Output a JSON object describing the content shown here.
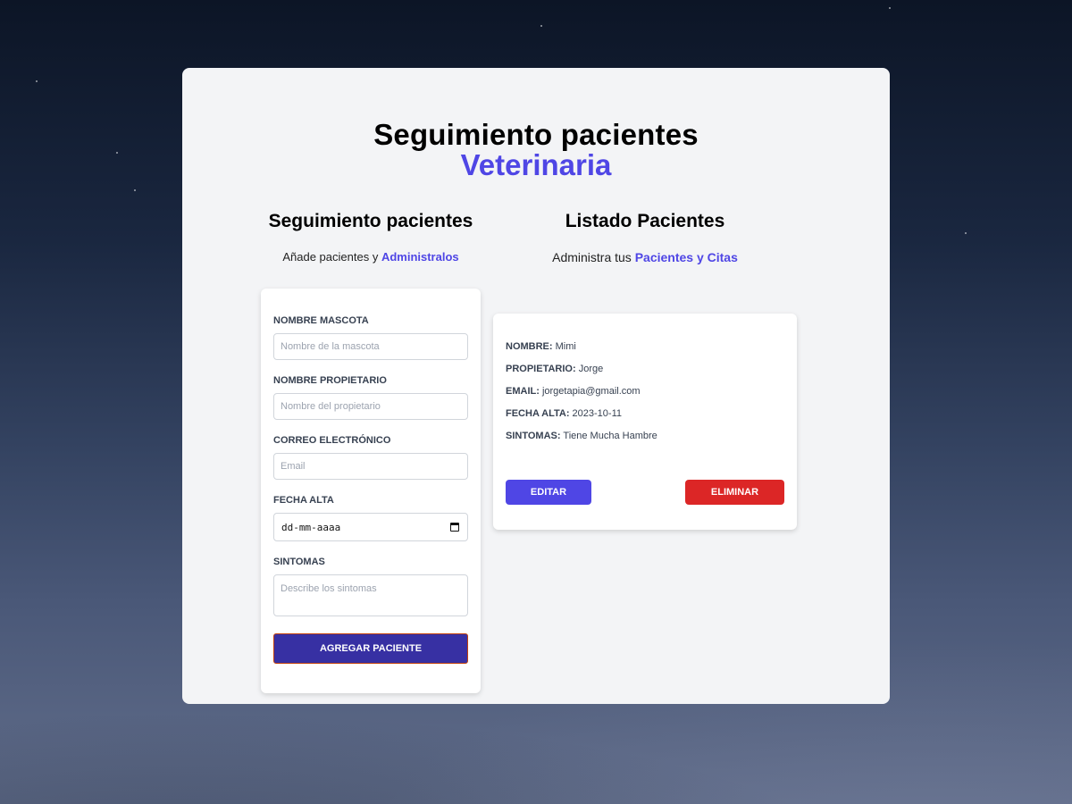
{
  "header": {
    "title": "Seguimiento pacientes",
    "subtitle": "Veterinaria"
  },
  "form_section": {
    "title": "Seguimiento pacientes",
    "sub_prefix": "Añade pacientes y ",
    "sub_accent": "Administralos"
  },
  "list_section": {
    "title": "Listado Pacientes",
    "sub_prefix": "Administra tus ",
    "sub_accent": "Pacientes y Citas"
  },
  "form": {
    "pet_name_label": "Nombre Mascota",
    "pet_name_placeholder": "Nombre de la mascota",
    "pet_name_value": "",
    "owner_label": "Nombre Propietario",
    "owner_placeholder": "Nombre del propietario",
    "owner_value": "",
    "email_label": "Correo Electrónico",
    "email_placeholder": "Email",
    "email_value": "",
    "date_label": "Fecha Alta",
    "date_display": "dd-mm-aaaa",
    "symptoms_label": "Sintomas",
    "symptoms_placeholder": "Describe los sintomas",
    "submit_label": "Agregar Paciente"
  },
  "patients": [
    {
      "name_key": "Nombre:",
      "name": "Mimi",
      "owner_key": "Propietario:",
      "owner": "Jorge",
      "email_key": "Email:",
      "email": "jorgetapia@gmail.com",
      "date_key": "Fecha Alta:",
      "date": "2023-10-11",
      "symptoms_key": "Sintomas:",
      "symptoms": "Tiene Mucha Hambre",
      "edit_label": "Editar",
      "delete_label": "Eliminar"
    }
  ],
  "colors": {
    "accent": "#4f46e5",
    "submit": "#3730a3",
    "danger": "#dc2626",
    "panel": "#f3f4f6"
  }
}
